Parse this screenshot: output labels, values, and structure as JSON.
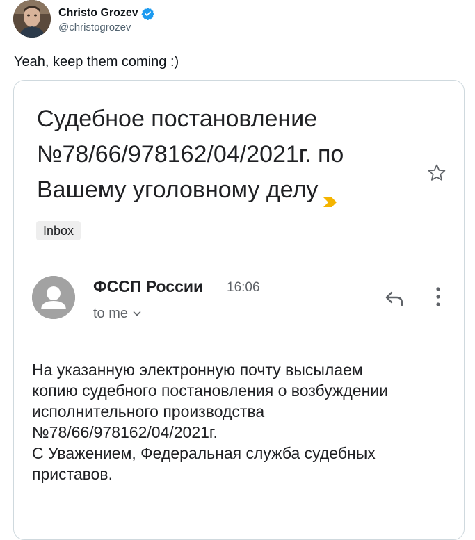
{
  "tweet": {
    "author_name": "Christo Grozev",
    "author_handle": "@christogrozev",
    "verified_icon": "verified-badge-icon",
    "text": "Yeah, keep them coming :)"
  },
  "email": {
    "subject": "Судебное постановление №78/66/978162/04/2021г. по Вашему уголовному делу",
    "label_chip": "Inbox",
    "sender_name": "ФССП России",
    "time": "16:06",
    "recipient": "to me",
    "body_lines": [
      "На указанную электронную почту высылаем",
      "копию судебного постановления о возбуждении",
      "исполнительного производства",
      "№78/66/978162/04/2021г.",
      "С Уважением, Федеральная служба судебных",
      "приставов."
    ],
    "colors": {
      "importance_marker": "#f4b400",
      "verified_badge": "#1d9bf0",
      "avatar_placeholder": "#a2a2a2"
    }
  }
}
